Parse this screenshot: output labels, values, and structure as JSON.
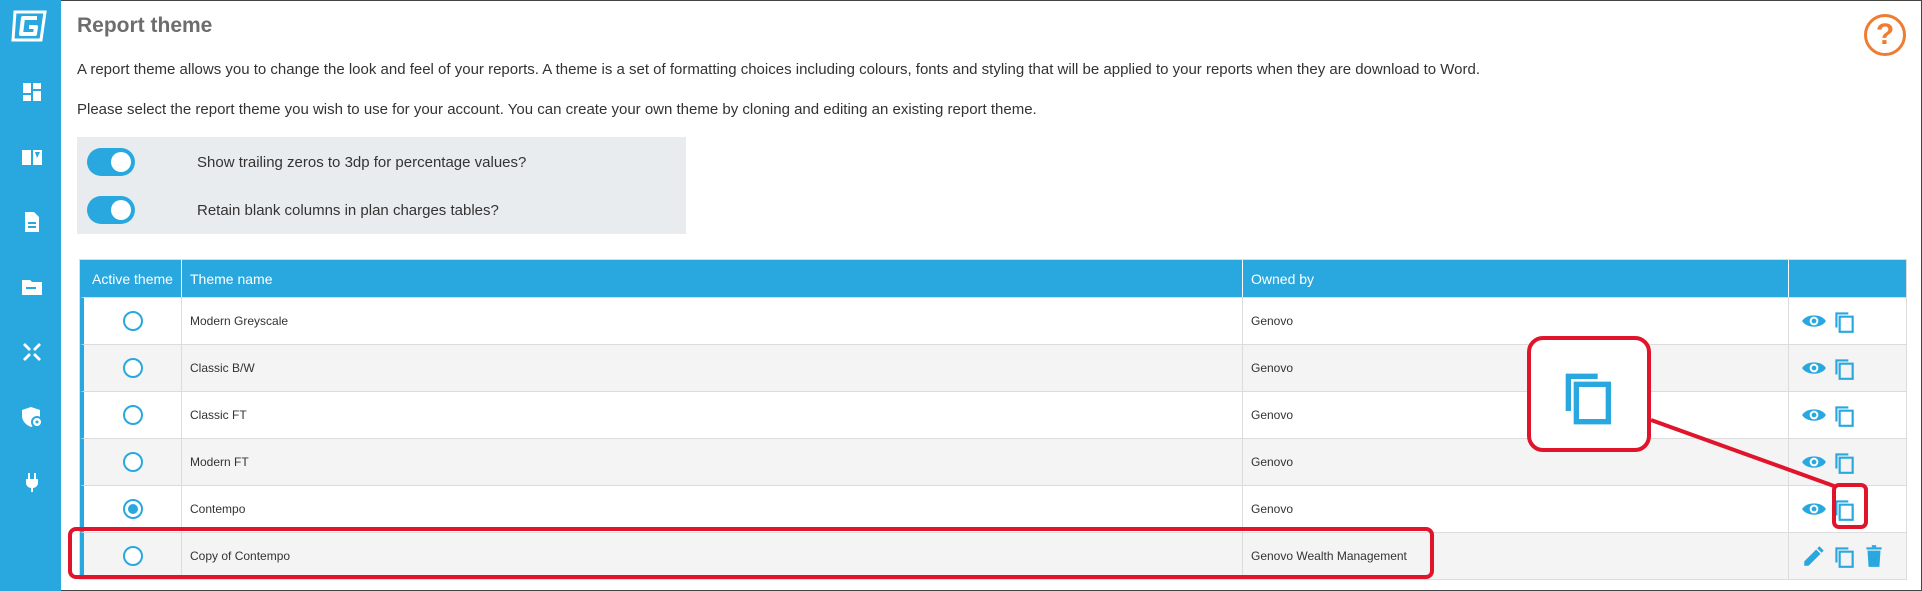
{
  "page": {
    "title": "Report theme",
    "help_glyph": "?",
    "description_1": "A report theme allows you to change the look and feel of your reports. A theme is a set of formatting choices including colours, fonts and styling that will be applied to your reports when they are download to Word.",
    "description_2": "Please select the report theme you wish to use for your account. You can create your own theme by cloning and editing an existing report theme."
  },
  "sidebar": {
    "logo": "genovo-logo",
    "items": [
      {
        "icon": "dashboard-icon"
      },
      {
        "icon": "book-icon"
      },
      {
        "icon": "document-icon"
      },
      {
        "icon": "folder-icon"
      },
      {
        "icon": "tools-icon"
      },
      {
        "icon": "security-settings-icon"
      },
      {
        "icon": "plug-icon"
      }
    ]
  },
  "options": [
    {
      "label": "Show trailing zeros to 3dp for percentage values?",
      "enabled": true
    },
    {
      "label": "Retain blank columns in plan charges tables?",
      "enabled": true
    }
  ],
  "table": {
    "headers": {
      "active": "Active theme",
      "name": "Theme name",
      "owner": "Owned by",
      "actions": ""
    },
    "rows": [
      {
        "name": "Modern Greyscale",
        "owner": "Genovo",
        "active": false
      },
      {
        "name": "Classic B/W",
        "owner": "Genovo",
        "active": false
      },
      {
        "name": "Classic FT",
        "owner": "Genovo",
        "active": false
      },
      {
        "name": "Modern FT",
        "owner": "Genovo",
        "active": false
      },
      {
        "name": "Contempo",
        "owner": "Genovo",
        "active": true
      },
      {
        "name": "Copy of Contempo",
        "owner": "Genovo Wealth Management",
        "active": false
      }
    ]
  },
  "colors": {
    "accent": "#29a8e0",
    "help": "#ee7d33",
    "annotation": "#e0142b"
  }
}
